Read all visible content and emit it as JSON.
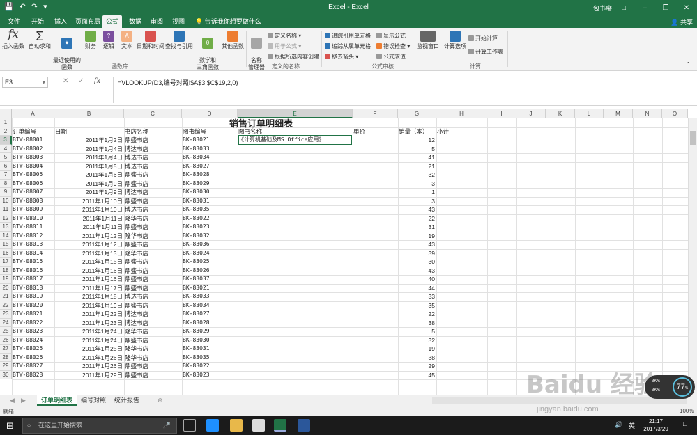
{
  "window": {
    "title": "Excel - Excel",
    "user": "包书磨",
    "share": "共享"
  },
  "tabs": [
    "文件",
    "开始",
    "插入",
    "页面布局",
    "公式",
    "数据",
    "审阅",
    "视图"
  ],
  "tell_me": "告诉我你想要做什么",
  "ribbon": {
    "insert_function": "插入函数",
    "autosum": "自动求和",
    "recent": "最近使用的\n函数",
    "financial": "财务",
    "logical": "逻辑",
    "text": "文本",
    "datetime": "日期和时间",
    "lookup": "查找与引用",
    "mathtrig": "数学和\n三角函数",
    "more": "其他函数",
    "group_library": "函数库",
    "name_manager": "名称\n管理器",
    "define_name": "定义名称",
    "use_in_formula": "用于公式",
    "create_from_sel": "根据所选内容创建",
    "group_names": "定义的名称",
    "trace_precedents": "追踪引用单元格",
    "trace_dependents": "追踪从属单元格",
    "remove_arrows": "移去箭头",
    "show_formulas": "显示公式",
    "error_checking": "错误检查",
    "evaluate": "公式求值",
    "group_audit": "公式审核",
    "watch": "监视窗口",
    "calc_options": "计算选项",
    "calc_now": "开始计算",
    "calc_sheet": "计算工作表",
    "group_calc": "计算"
  },
  "formula_bar": {
    "cell_ref": "E3",
    "formula": "=VLOOKUP(D3,编号对照!$A$3:$C$19,2,0)"
  },
  "columns": [
    "A",
    "B",
    "C",
    "D",
    "E",
    "F",
    "G",
    "H",
    "I",
    "J",
    "K",
    "L",
    "M",
    "N",
    "O"
  ],
  "sheet": {
    "title": "销售订单明细表",
    "headers": [
      "订单编号",
      "日期",
      "书店名称",
      "图书编号",
      "图书名称",
      "单价",
      "销量（本）",
      "小计"
    ],
    "e3": "《计算机基础及MS Office应用》",
    "rows": [
      [
        "BTW-08001",
        "2011年1月2日",
        "鼎盛书店",
        "BK-83021",
        "12"
      ],
      [
        "BTW-08002",
        "2011年1月4日",
        "博达书店",
        "BK-83033",
        "5"
      ],
      [
        "BTW-08003",
        "2011年1月4日",
        "博达书店",
        "BK-83034",
        "41"
      ],
      [
        "BTW-08004",
        "2011年1月5日",
        "博达书店",
        "BK-83027",
        "21"
      ],
      [
        "BTW-08005",
        "2011年1月6日",
        "鼎盛书店",
        "BK-83028",
        "32"
      ],
      [
        "BTW-08006",
        "2011年1月9日",
        "鼎盛书店",
        "BK-83029",
        "3"
      ],
      [
        "BTW-08007",
        "2011年1月9日",
        "博达书店",
        "BK-83030",
        "1"
      ],
      [
        "BTW-08008",
        "2011年1月10日",
        "鼎盛书店",
        "BK-83031",
        "3"
      ],
      [
        "BTW-08009",
        "2011年1月10日",
        "博达书店",
        "BK-83035",
        "43"
      ],
      [
        "BTW-08010",
        "2011年1月11日",
        "隆华书店",
        "BK-83022",
        "22"
      ],
      [
        "BTW-08011",
        "2011年1月11日",
        "鼎盛书店",
        "BK-83023",
        "31"
      ],
      [
        "BTW-08012",
        "2011年1月12日",
        "隆华书店",
        "BK-83032",
        "19"
      ],
      [
        "BTW-08013",
        "2011年1月12日",
        "鼎盛书店",
        "BK-83036",
        "43"
      ],
      [
        "BTW-08014",
        "2011年1月13日",
        "隆华书店",
        "BK-83024",
        "39"
      ],
      [
        "BTW-08015",
        "2011年1月15日",
        "鼎盛书店",
        "BK-83025",
        "30"
      ],
      [
        "BTW-08016",
        "2011年1月16日",
        "鼎盛书店",
        "BK-83026",
        "43"
      ],
      [
        "BTW-08017",
        "2011年1月16日",
        "鼎盛书店",
        "BK-83037",
        "40"
      ],
      [
        "BTW-08018",
        "2011年1月17日",
        "鼎盛书店",
        "BK-83021",
        "44"
      ],
      [
        "BTW-08019",
        "2011年1月18日",
        "博达书店",
        "BK-83033",
        "33"
      ],
      [
        "BTW-08020",
        "2011年1月19日",
        "鼎盛书店",
        "BK-83034",
        "35"
      ],
      [
        "BTW-08021",
        "2011年1月22日",
        "博达书店",
        "BK-83027",
        "22"
      ],
      [
        "BTW-08022",
        "2011年1月23日",
        "博达书店",
        "BK-83028",
        "38"
      ],
      [
        "BTW-08023",
        "2011年1月24日",
        "隆华书店",
        "BK-83029",
        "5"
      ],
      [
        "BTW-08024",
        "2011年1月24日",
        "鼎盛书店",
        "BK-83030",
        "32"
      ],
      [
        "BTW-08025",
        "2011年1月25日",
        "隆华书店",
        "BK-83031",
        "19"
      ],
      [
        "BTW-08026",
        "2011年1月26日",
        "隆华书店",
        "BK-83035",
        "38"
      ],
      [
        "BTW-08027",
        "2011年1月26日",
        "鼎盛书店",
        "BK-83022",
        "29"
      ],
      [
        "BTW-08028",
        "2011年1月29日",
        "鼎盛书店",
        "BK-83023",
        "45"
      ]
    ]
  },
  "sheet_tabs": [
    "订单明细表",
    "编号对照",
    "统计报告"
  ],
  "status": {
    "ready": "就绪",
    "zoom": "100%"
  },
  "taskbar": {
    "search": "在这里开始搜索",
    "time": "21:17",
    "date": "2017/3/29",
    "lang": "英"
  },
  "badge": {
    "percent": "77",
    "speed_up": "3K/s",
    "speed_down": "3K/s"
  },
  "watermark": {
    "main": "Baidu 经验",
    "sub": "jingyan.baidu.com"
  }
}
